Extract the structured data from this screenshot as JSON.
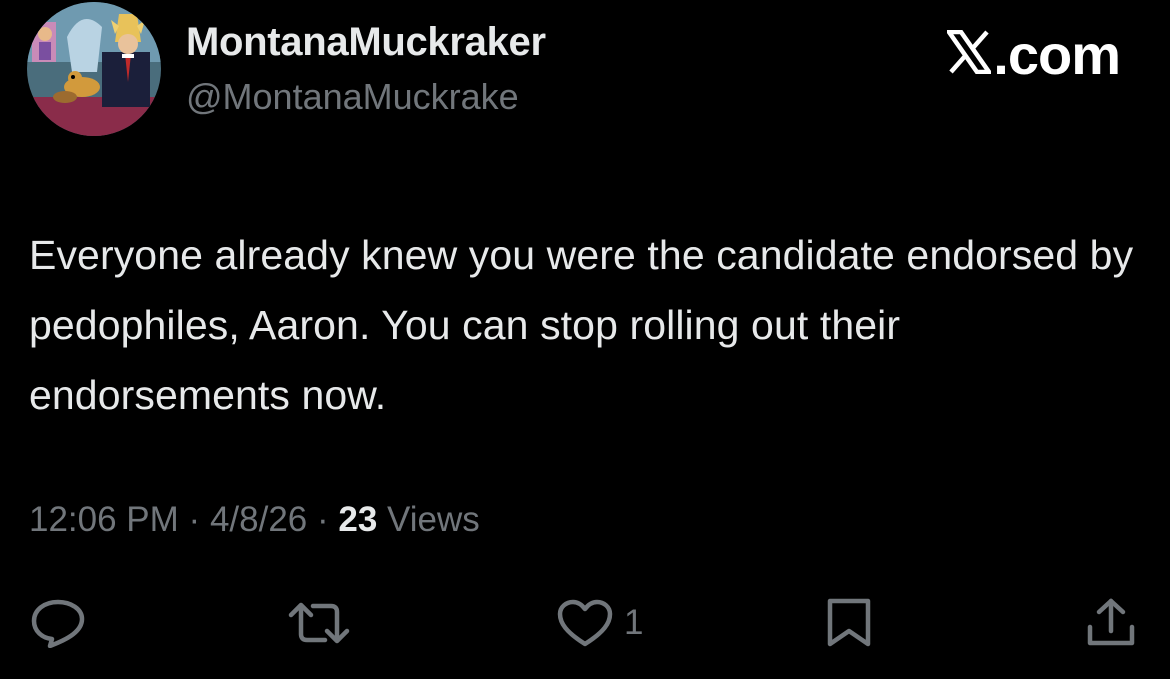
{
  "author": {
    "display_name": "MontanaMuckraker",
    "handle": "@MontanaMuckrake",
    "avatar_icon": "cartoon-avatar-image"
  },
  "brand": {
    "label": ".com",
    "icon": "x-logo-icon"
  },
  "tweet": {
    "text": "Everyone already knew you were the candidate endorsed by pedophiles, Aaron. You can stop rolling out their endorsements now."
  },
  "meta": {
    "time": "12:06 PM",
    "separator": "·",
    "date": "4/8/26",
    "views_count": "23",
    "views_label": "Views"
  },
  "actions": {
    "reply_icon": "reply-icon",
    "retweet_icon": "retweet-icon",
    "like_icon": "heart-icon",
    "like_count": "1",
    "bookmark_icon": "bookmark-icon",
    "share_icon": "share-icon"
  },
  "colors": {
    "background": "#000000",
    "primary_text": "#e7e9ea",
    "secondary_text": "#71767b"
  }
}
